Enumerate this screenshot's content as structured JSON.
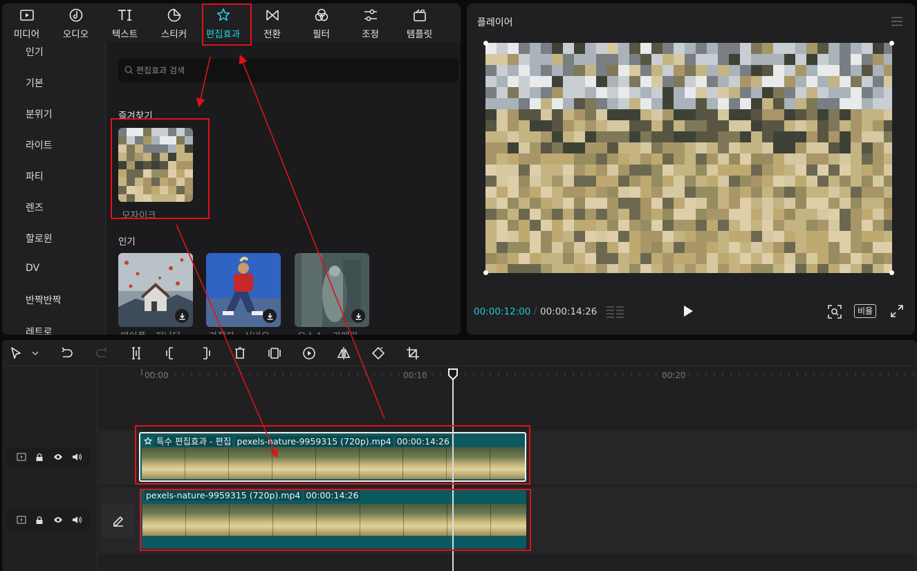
{
  "tabs": [
    {
      "label": "미디어",
      "icon": "media-icon"
    },
    {
      "label": "오디오",
      "icon": "audio-icon"
    },
    {
      "label": "텍스트",
      "icon": "text-icon"
    },
    {
      "label": "스티커",
      "icon": "sticker-icon"
    },
    {
      "label": "편집효과",
      "icon": "effects-icon",
      "active": true
    },
    {
      "label": "전환",
      "icon": "transition-icon"
    },
    {
      "label": "필터",
      "icon": "filter-icon"
    },
    {
      "label": "조정",
      "icon": "adjust-icon"
    },
    {
      "label": "템플릿",
      "icon": "template-icon"
    }
  ],
  "sidebar": [
    "인기",
    "기본",
    "분위기",
    "라이트",
    "파티",
    "렌즈",
    "할로윈",
    "DV",
    "반짝반짝",
    "레트로"
  ],
  "search": {
    "placeholder": "편집효과 검색"
  },
  "favorites": {
    "title": "즐겨찾기",
    "items": [
      {
        "name": "모자이크"
      }
    ]
  },
  "popular": {
    "title": "인기",
    "items": [
      {
        "name": "메이플 - 지나다"
      },
      {
        "name": "가장자 - 신비오"
      },
      {
        "name": "으스스 - 카메라"
      }
    ]
  },
  "player": {
    "title": "플레이어",
    "current_time": "00:00:12:00",
    "separator": "/",
    "total_time": "00:00:14:26",
    "ratio_label": "비율"
  },
  "ruler": [
    "00:00",
    "00:10",
    "00:20"
  ],
  "clips": {
    "effect": {
      "label": "특수 편집효과 - 편집",
      "file": "pexels-nature-9959315 (720p).mp4",
      "duration": "00:00:14:26"
    },
    "main": {
      "file": "pexels-nature-9959315 (720p).mp4",
      "duration": "00:00:14:26"
    }
  },
  "colors": {
    "accent": "#22d3e0",
    "clip": "#0c5a60",
    "highlight": "#e0121a"
  }
}
